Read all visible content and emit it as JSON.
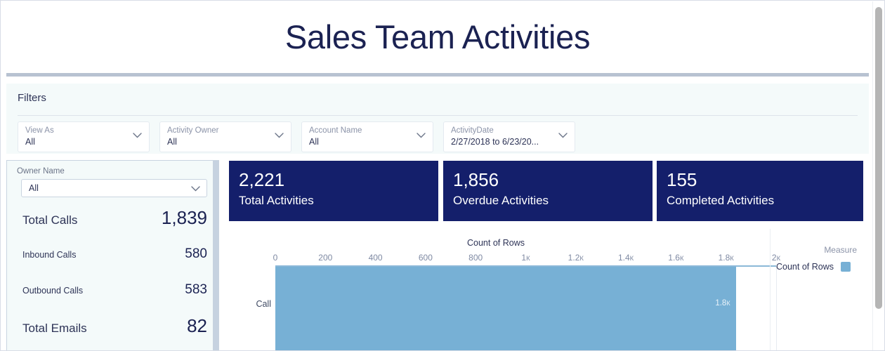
{
  "header": {
    "title": "Sales Team Activities"
  },
  "filters": {
    "section_label": "Filters",
    "items": [
      {
        "caption": "View As",
        "value": "All",
        "icon": "chevron-down-icon"
      },
      {
        "caption": "Activity Owner",
        "value": "All",
        "icon": "chevron-down-icon"
      },
      {
        "caption": "Account Name",
        "value": "All",
        "icon": "chevron-down-icon"
      },
      {
        "caption": "ActivityDate",
        "value": "2/27/2018 to 6/23/20...",
        "icon": "chevron-down-icon"
      }
    ]
  },
  "left_panel": {
    "owner_label": "Owner Name",
    "owner_value": "All",
    "metrics": [
      {
        "label": "Total Calls",
        "value": "1,839"
      },
      {
        "label": "Inbound Calls",
        "value": "580"
      },
      {
        "label": "Outbound Calls",
        "value": "583"
      },
      {
        "label": "Total Emails",
        "value": "82"
      }
    ]
  },
  "kpis": [
    {
      "value": "2,221",
      "label": "Total Activities"
    },
    {
      "value": "1,856",
      "label": "Overdue Activities"
    },
    {
      "value": "155",
      "label": "Completed Activities"
    }
  ],
  "chart_legend": {
    "title": "Measure",
    "entry": "Count of Rows",
    "color": "#77b0d5"
  },
  "colors": {
    "kpi_background": "#141f6b",
    "bar": "#77b0d5",
    "panel_background": "#f4fafa",
    "title_text": "#1b2252"
  },
  "chart_data": {
    "type": "bar",
    "orientation": "horizontal",
    "title": "Count of Rows",
    "xlabel": "",
    "ylabel": "",
    "categories": [
      "Call"
    ],
    "values": [
      1839
    ],
    "data_labels": [
      "1.8к"
    ],
    "xlim": [
      0,
      2000
    ],
    "xticks": [
      0,
      200,
      400,
      600,
      800,
      1000,
      1200,
      1400,
      1600,
      1800,
      2000
    ],
    "xtick_labels": [
      "0",
      "200",
      "400",
      "600",
      "800",
      "1к",
      "1.2к",
      "1.4к",
      "1.6к",
      "1.8к",
      "2к"
    ],
    "grid": true,
    "legend_position": "right",
    "series": [
      {
        "name": "Count of Rows",
        "values": [
          1839
        ],
        "color": "#77b0d5"
      }
    ]
  }
}
